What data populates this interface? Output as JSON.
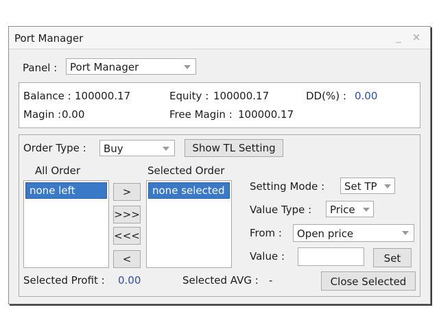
{
  "window": {
    "title": "Port Manager",
    "minimize_glyph": "_",
    "close_glyph": "×"
  },
  "panel_selector": {
    "label": "Panel :",
    "value": "Port Manager"
  },
  "account": {
    "balance_label": "Balance :",
    "balance_value": "100000.17",
    "equity_label": "Equity :",
    "equity_value": "100000.17",
    "dd_label": "DD(%) :",
    "dd_value": "0.00",
    "margin_label": "Magin :",
    "margin_value": "0.00",
    "free_margin_label": "Free Magin :",
    "free_margin_value": "100000.17"
  },
  "order": {
    "type_label": "Order Type :",
    "type_value": "Buy",
    "show_tl_button": "Show TL Setting"
  },
  "lists": {
    "all_header": "All Order",
    "all_items": [
      "none left"
    ],
    "selected_header": "Selected Order",
    "selected_items": [
      "none selected"
    ],
    "move_right": ">",
    "move_all_right": ">>>",
    "move_all_left": "<<<",
    "move_left": "<"
  },
  "settings": {
    "mode_label": "Setting Mode :",
    "mode_value": "Set TP",
    "value_type_label": "Value Type :",
    "value_type_value": "Price",
    "from_label": "From :",
    "from_value": "Open price",
    "value_label": "Value :",
    "value_input": "",
    "set_button": "Set"
  },
  "footer": {
    "profit_label": "Selected Profit :",
    "profit_value": "0.00",
    "avg_label": "Selected AVG :",
    "avg_value": "-",
    "close_button": "Close Selected"
  }
}
